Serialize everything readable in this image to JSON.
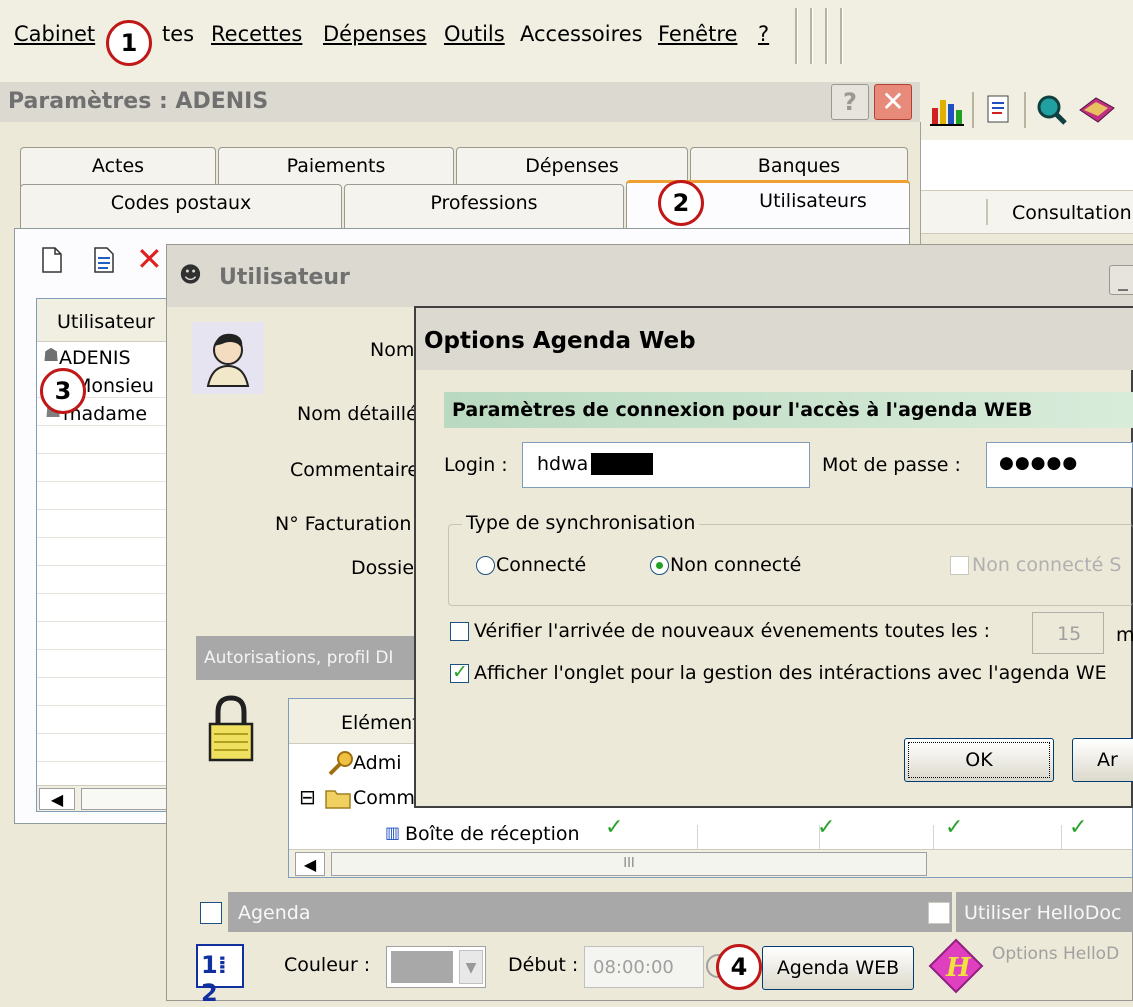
{
  "menubar": {
    "items": [
      "Cabinet",
      "tes",
      "Recettes",
      "Dépenses",
      "Outils",
      "Accessoires",
      "Fenêtre",
      "?"
    ]
  },
  "callouts": [
    "1",
    "2",
    "3",
    "4"
  ],
  "params_window": {
    "title": "Paramètres : ADENIS",
    "help_label": "?",
    "tabs_row1": [
      "Actes",
      "Paiements",
      "Dépenses",
      "Banques"
    ],
    "tabs_row2": [
      "Codes postaux",
      "Professions",
      "Utilisateurs"
    ],
    "list_header": "Utilisateur",
    "users": [
      "ADENIS",
      "Monsieu",
      "madame"
    ]
  },
  "bg_right": {
    "consultation_header": "Consultation"
  },
  "user_window": {
    "title": "Utilisateur",
    "minimize_label": "_",
    "labels": {
      "nom": "Nom",
      "nom_detaille": "Nom détaillé",
      "commentaire": "Commentaire",
      "facturation": "N° Facturation",
      "dossier": "Dossie"
    },
    "autorisations_header": "Autorisations, profil DI",
    "tree": {
      "header": "Elément",
      "items": [
        "Admi",
        "Comm",
        "Boîte de réception"
      ],
      "expander": "⊟",
      "scroll_mid": "III"
    },
    "agenda": {
      "label": "Agenda",
      "checked": false,
      "couleur_label": "Couleur :",
      "debut_label": "Début :",
      "debut_value": "08:00:00",
      "agenda_web_button": "Agenda WEB",
      "hellodoc_label": "Utiliser HelloDoc",
      "options_hellodoc": "Options HelloD"
    }
  },
  "dialog": {
    "title": "Options Agenda Web",
    "section_header": "Paramètres de connexion pour l'accès à l'agenda WEB",
    "login_label": "Login :",
    "login_value": "hdwa",
    "password_label": "Mot de passe :",
    "password_value": "●●●●●",
    "sync_group_label": "Type de synchronisation",
    "sync_options": [
      "Connecté",
      "Non connecté",
      "Non connecté S"
    ],
    "sync_selected": "Non connecté",
    "verify_label": "Vérifier l'arrivée de nouveaux évenements toutes les :",
    "verify_checked": false,
    "verify_value": "15",
    "verify_unit": "m",
    "show_tab_label": "Afficher l'onglet pour la gestion des intéractions avec l'agenda WE",
    "show_tab_checked": true,
    "ok_label": "OK",
    "cancel_label": "Ar"
  },
  "colors": {
    "callout_border": "#c01818",
    "check_green": "#21a121",
    "section_header_bg": "#b9d9c0",
    "accent_tab": "#f0a030"
  }
}
